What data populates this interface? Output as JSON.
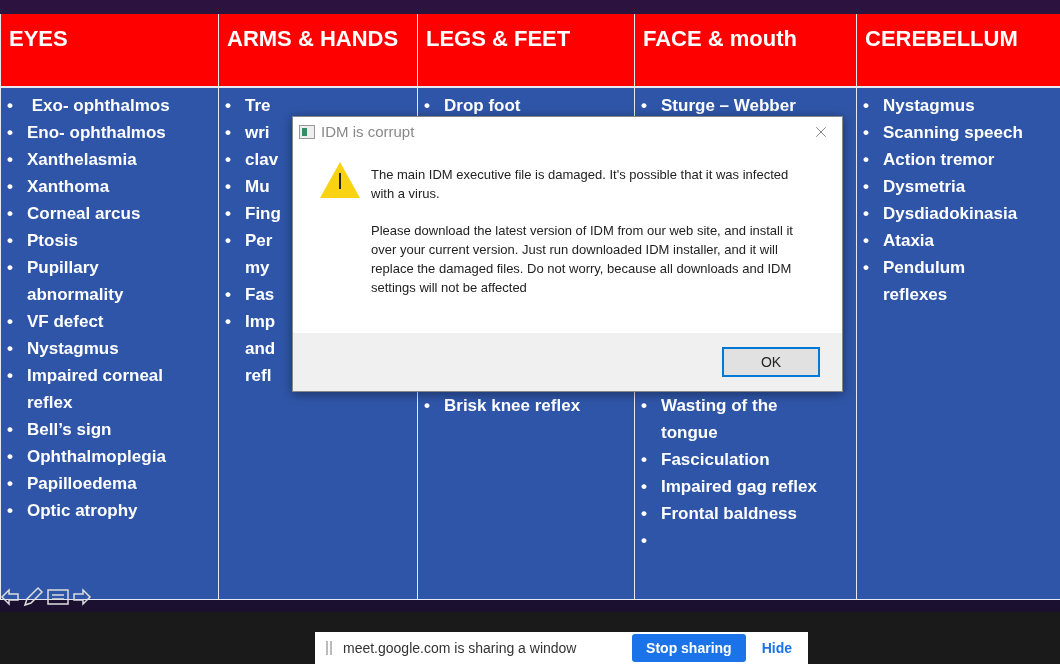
{
  "slide": {
    "columns": [
      {
        "header": "EYES",
        "items": [
          {
            "bullet": "•",
            "lines": [
              " Exo- ophthalmos"
            ]
          },
          {
            "bullet": "•",
            "lines": [
              "Eno- ophthalmos"
            ]
          },
          {
            "bullet": "•",
            "lines": [
              "Xanthelasmia"
            ]
          },
          {
            "bullet": "•",
            "lines": [
              "Xanthoma"
            ]
          },
          {
            "bullet": "•",
            "lines": [
              "Corneal arcus"
            ]
          },
          {
            "bullet": "•",
            "lines": [
              "Ptosis"
            ]
          },
          {
            "bullet": "•",
            "lines": [
              "Pupillary",
              "abnormality"
            ]
          },
          {
            "bullet": "•",
            "lines": [
              "VF defect"
            ]
          },
          {
            "bullet": "•",
            "lines": [
              "Nystagmus"
            ]
          },
          {
            "bullet": "•",
            "lines": [
              "Impaired corneal",
              "reflex"
            ]
          },
          {
            "bullet": "•",
            "lines": [
              "Bell’s sign"
            ]
          },
          {
            "bullet": "•",
            "lines": [
              "Ophthalmoplegia"
            ]
          },
          {
            "bullet": "•",
            "lines": [
              "Papilloedema"
            ]
          },
          {
            "bullet": "•",
            "lines": [
              "Optic atrophy"
            ]
          }
        ]
      },
      {
        "header": "ARMS & HANDS",
        "items": [
          {
            "bullet": "•",
            "lines": [
              "Tre"
            ]
          },
          {
            "bullet": "•",
            "lines": [
              "wri"
            ]
          },
          {
            "bullet": "•",
            "lines": [
              "clav"
            ]
          },
          {
            "bullet": "•",
            "lines": [
              "Mu"
            ]
          },
          {
            "bullet": "•",
            "lines": [
              "Fing"
            ]
          },
          {
            "bullet": "•",
            "lines": [
              "Per",
              "my"
            ]
          },
          {
            "bullet": "•",
            "lines": [
              "Fas"
            ]
          },
          {
            "bullet": "•",
            "lines": [
              "Imp",
              "and",
              "refl"
            ]
          }
        ]
      },
      {
        "header": "LEGS & FEET",
        "items": [
          {
            "bullet": "•",
            "lines": [
              "Drop foot"
            ]
          }
        ],
        "items_below": [
          {
            "bullet": "•",
            "lines": [
              "Brisk knee reflex"
            ]
          }
        ]
      },
      {
        "header": "FACE & mouth",
        "items": [
          {
            "bullet": "•",
            "lines": [
              "Sturge – Webber"
            ]
          }
        ],
        "items_below": [
          {
            "bullet": "•",
            "lines": [
              "Wasting of the",
              "tongue"
            ]
          },
          {
            "bullet": "•",
            "lines": [
              "Fasciculation"
            ]
          },
          {
            "bullet": "•",
            "lines": [
              "Impaired gag reflex"
            ]
          },
          {
            "bullet": "•",
            "lines": [
              "Frontal baldness"
            ]
          },
          {
            "bullet": "•"
          }
        ]
      },
      {
        "header": "CEREBELLUM",
        "items": [
          {
            "bullet": "•",
            "lines": [
              "Nystagmus"
            ]
          },
          {
            "bullet": "•",
            "lines": [
              "Scanning speech"
            ]
          },
          {
            "bullet": "•",
            "lines": [
              "Action tremor"
            ]
          },
          {
            "bullet": "•",
            "lines": [
              "Dysmetria"
            ]
          },
          {
            "bullet": "•",
            "lines": [
              "Dysdiadokinasia"
            ]
          },
          {
            "bullet": "•",
            "lines": [
              "Ataxia"
            ]
          },
          {
            "bullet": "•",
            "lines": [
              "Pendulum",
              "reflexes"
            ]
          }
        ]
      }
    ]
  },
  "dialog": {
    "title": "IDM is corrupt",
    "paragraphs": [
      "The main IDM executive file is damaged. It's possible that it was infected with a virus.",
      "Please download the latest version of IDM from our web site, and install it over your current version. Just run downloaded IDM installer, and it will replace the damaged files. Do not worry, because all downloads and IDM settings will not be affected"
    ],
    "button": "OK"
  },
  "sharing_bar": {
    "message": "meet.google.com is sharing a window",
    "stop_button": "Stop sharing",
    "hide_link": "Hide"
  }
}
